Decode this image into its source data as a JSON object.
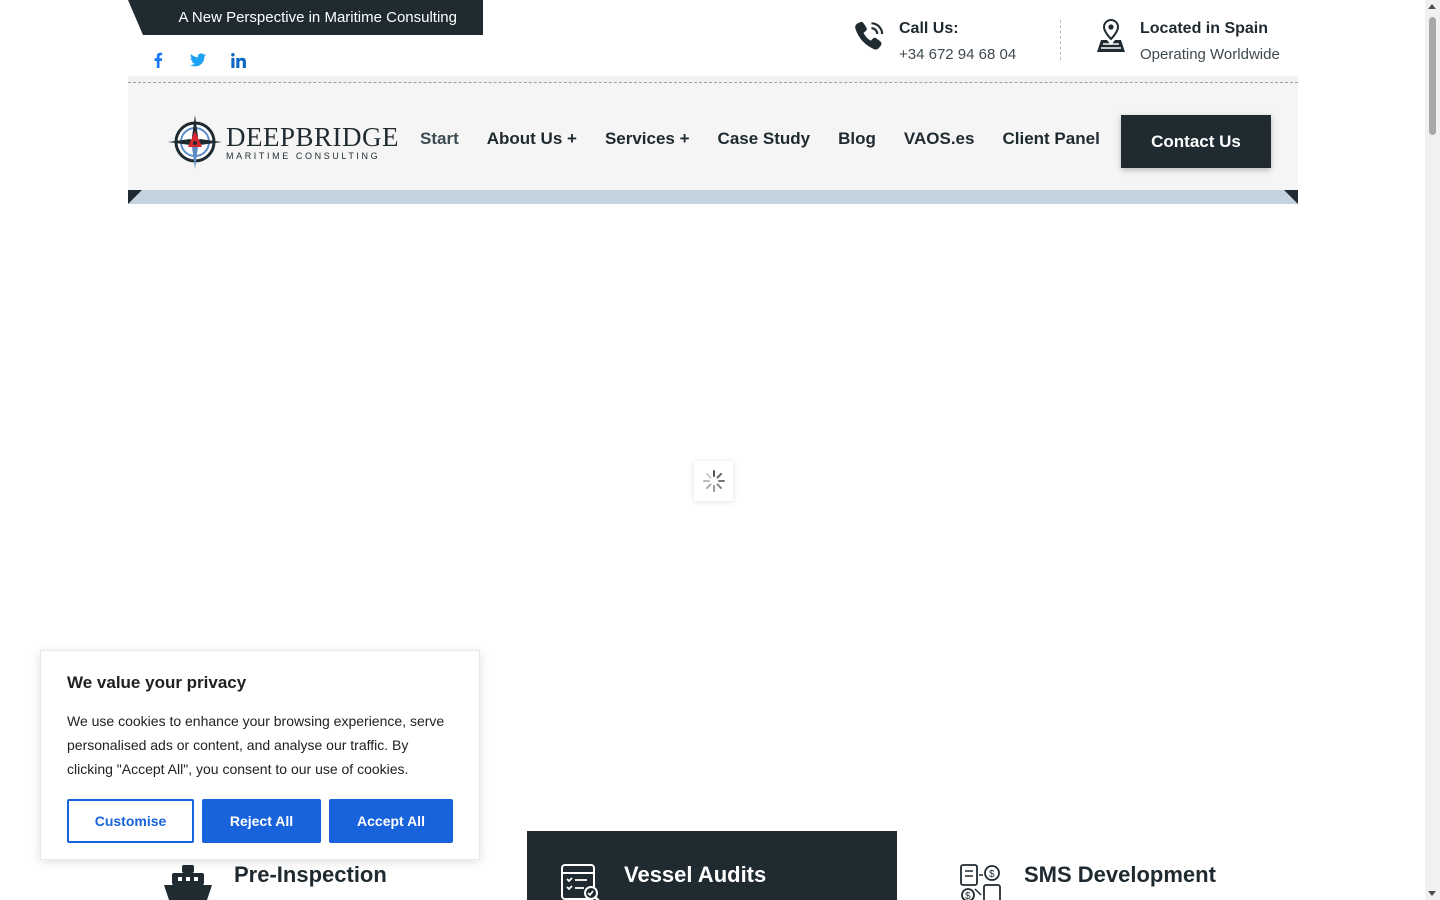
{
  "topbar": {
    "tagline": "A New Perspective in Maritime Consulting",
    "socials": [
      {
        "name": "facebook-icon",
        "color": "#1877f2"
      },
      {
        "name": "twitter-icon",
        "color": "#1da1f2"
      },
      {
        "name": "linkedin-icon",
        "color": "#0a66c2"
      }
    ],
    "call": {
      "label": "Call Us:",
      "value": "+34 672 94 68 04"
    },
    "location": {
      "label": "Located in Spain",
      "value": "Operating Worldwide"
    }
  },
  "header": {
    "logo": {
      "brand": "DEEPBRIDGE",
      "sub": "MARITIME CONSULTING"
    },
    "nav": [
      {
        "label": "Start",
        "active": true
      },
      {
        "label": "About Us +"
      },
      {
        "label": "Services +"
      },
      {
        "label": "Case Study"
      },
      {
        "label": "Blog"
      },
      {
        "label": "VAOS.es"
      },
      {
        "label": "Client Panel"
      }
    ],
    "cta": "Contact Us"
  },
  "services": [
    {
      "title": "Pre-Inspection"
    },
    {
      "title": "Vessel Audits"
    },
    {
      "title": "SMS Development"
    }
  ],
  "cookie": {
    "title": "We value your privacy",
    "body": "We use cookies to enhance your browsing experience, serve personalised ads or content, and analyse our traffic. By clicking \"Accept All\", you consent to our use of cookies.",
    "customise": "Customise",
    "reject": "Reject All",
    "accept": "Accept All"
  },
  "colors": {
    "dark": "#1f2b31",
    "accent": "#1863dc",
    "strip": "#c5d3de"
  }
}
